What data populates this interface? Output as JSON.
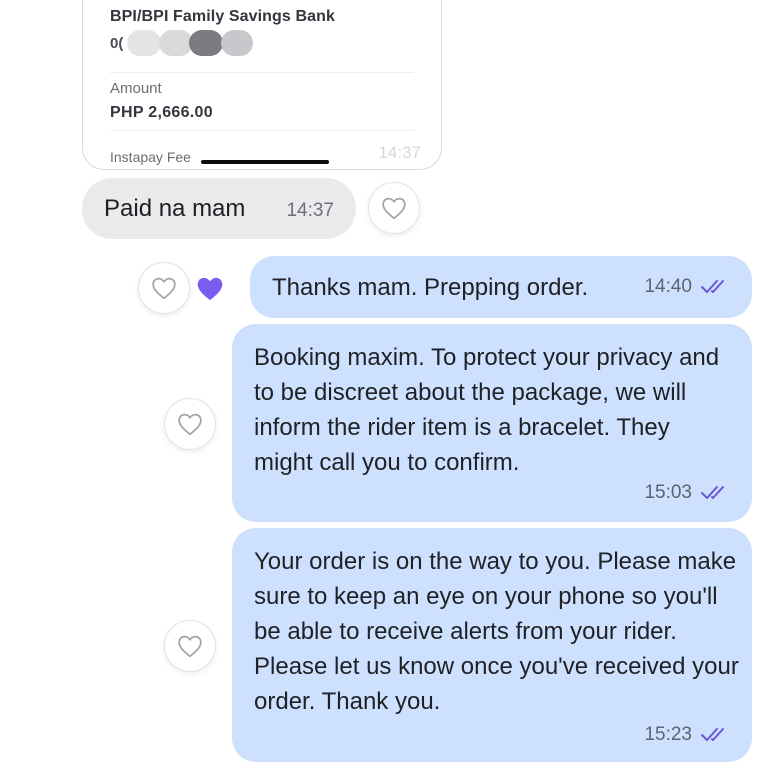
{
  "receipt": {
    "bank_name": "BPI/BPI Family Savings Bank",
    "account_prefix": "0(",
    "amount_label": "Amount",
    "amount_value": "PHP 2,666.00",
    "fee_label": "Instapay Fee",
    "time": "14:37"
  },
  "messages": [
    {
      "direction": "incoming",
      "text": "Paid na mam",
      "time": "14:37",
      "reaction": "none"
    },
    {
      "direction": "outgoing",
      "text": "Thanks mam. Prepping order.",
      "time": "14:40",
      "status": "read",
      "reaction": "heart"
    },
    {
      "direction": "outgoing",
      "text": "Booking maxim. To protect your privacy and to be discreet about the package, we will inform the rider item is a bracelet. They might call you to confirm.",
      "time": "15:03",
      "status": "read",
      "reaction": "none"
    },
    {
      "direction": "outgoing",
      "text": "Your order is on the way to you. Please make sure to keep an eye on your phone so you'll be able to receive alerts from your rider. Please let us know once you've received your order. Thank you.",
      "time": "15:23",
      "status": "read",
      "reaction": "none"
    }
  ],
  "colors": {
    "outgoing_bubble": "#cde0fd",
    "incoming_bubble": "#eaeaec",
    "heart_reaction": "#7b5cf0",
    "read_ticks": "#6a57d8"
  },
  "icons": {
    "reaction": "heart-outline-icon",
    "reaction_selected": "heart-filled-icon",
    "status": "double-check-icon"
  }
}
